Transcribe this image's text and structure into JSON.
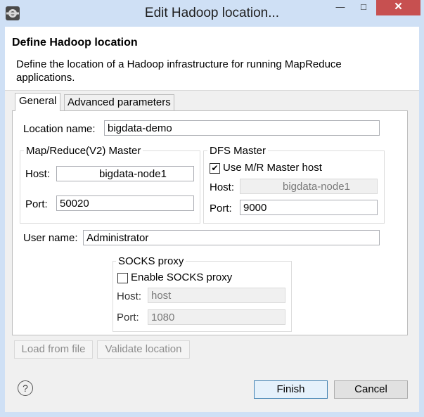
{
  "window": {
    "title": "Edit Hadoop location...",
    "minimize_glyph": "—",
    "maximize_glyph": "□",
    "close_glyph": "✕"
  },
  "header": {
    "title": "Define Hadoop location",
    "description": "Define the location of a Hadoop infrastructure for running MapReduce applications."
  },
  "tabs": {
    "general": "General",
    "advanced": "Advanced parameters"
  },
  "general": {
    "location_name_label": "Location name:",
    "location_name_value": "bigdata-demo",
    "mr_master": {
      "title": "Map/Reduce(V2) Master",
      "host_label": "Host:",
      "host_value": "bigdata-node1",
      "port_label": "Port:",
      "port_value": "50020"
    },
    "dfs_master": {
      "title": "DFS Master",
      "use_mr_label": "Use M/R Master host",
      "use_mr_checked": true,
      "check_glyph": "✔",
      "host_label": "Host:",
      "host_value": "bigdata-node1",
      "port_label": "Port:",
      "port_value": "9000"
    },
    "user_name_label": "User name:",
    "user_name_value": "Administrator",
    "socks": {
      "title": "SOCKS proxy",
      "enable_label": "Enable SOCKS proxy",
      "enable_checked": false,
      "host_label": "Host:",
      "host_value": "host",
      "port_label": "Port:",
      "port_value": "1080"
    }
  },
  "buttons": {
    "load_from_file": "Load from file",
    "validate_location": "Validate location",
    "finish": "Finish",
    "cancel": "Cancel",
    "help_glyph": "?"
  },
  "colors": {
    "titlebar": "#cfe0f5",
    "close_button": "#c75050",
    "dialog_bg": "#f0f0f0"
  }
}
